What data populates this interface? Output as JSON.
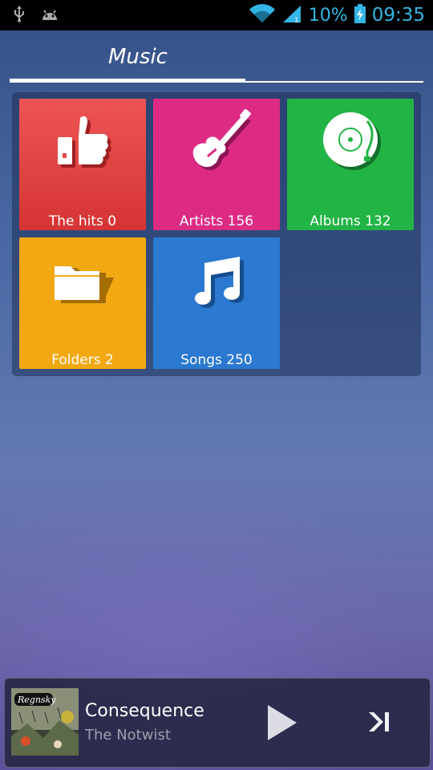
{
  "status_bar": {
    "battery": "10%",
    "time": "09:35",
    "accent": "#33b5e5",
    "icons": [
      "usb-icon",
      "android-debug-icon",
      "wifi-icon",
      "signal-icon",
      "battery-charging-icon"
    ]
  },
  "tabs": [
    {
      "label": "Music",
      "selected": true
    }
  ],
  "tiles": [
    {
      "label": "The hits 0",
      "icon": "thumbs-up-icon",
      "color": "#e84a4a"
    },
    {
      "label": "Artists 156",
      "icon": "guitar-icon",
      "color": "#dd2b84"
    },
    {
      "label": "Albums 132",
      "icon": "turntable-icon",
      "color": "#22b445"
    },
    {
      "label": "Folders 2",
      "icon": "folder-icon",
      "color": "#f2a812"
    },
    {
      "label": "Songs 250",
      "icon": "music-note-icon",
      "color": "#2b79d0"
    }
  ],
  "now_playing": {
    "title": "Consequence",
    "artist": "The Notwist",
    "album_art_text": "Regnsky",
    "controls": [
      "play-icon",
      "skip-next-icon"
    ]
  }
}
